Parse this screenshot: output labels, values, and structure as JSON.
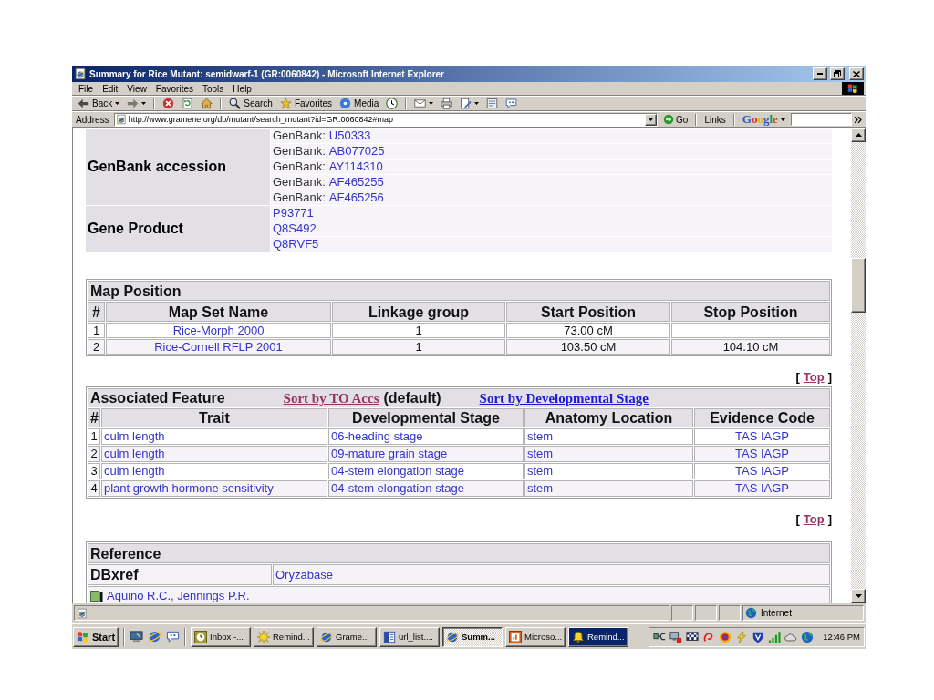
{
  "window": {
    "title": "Summary for Rice Mutant: semidwarf-1 (GR:0060842) - Microsoft Internet Explorer"
  },
  "menu": [
    "File",
    "Edit",
    "View",
    "Favorites",
    "Tools",
    "Help"
  ],
  "toolbar": [
    {
      "buttons": [
        {
          "kind": "back",
          "label": "Back"
        },
        {
          "kind": "forward"
        }
      ]
    },
    {
      "buttons": [
        {
          "kind": "stop"
        },
        {
          "kind": "refresh"
        },
        {
          "kind": "home"
        }
      ]
    },
    {
      "buttons": [
        {
          "kind": "search",
          "label": "Search"
        },
        {
          "kind": "favorites",
          "label": "Favorites"
        },
        {
          "kind": "media",
          "label": "Media"
        },
        {
          "kind": "history"
        }
      ]
    },
    {
      "buttons": [
        {
          "kind": "mail"
        },
        {
          "kind": "print"
        },
        {
          "kind": "edit"
        },
        {
          "kind": "discuss"
        },
        {
          "kind": "messenger"
        }
      ]
    }
  ],
  "address_bar": {
    "label": "Address",
    "url": "http://www.gramene.org/db/mutant/search_mutant?id=GR:0060842#map",
    "go": "Go",
    "links": "Links",
    "search_brand": "Google"
  },
  "content": {
    "xrefs": [
      {
        "label": "GenBank accession",
        "entries": [
          {
            "prefix": "GenBank:",
            "link": "U50333"
          },
          {
            "prefix": "GenBank:",
            "link": "AB077025"
          },
          {
            "prefix": "GenBank:",
            "link": "AY114310"
          },
          {
            "prefix": "GenBank:",
            "link": "AF465255"
          },
          {
            "prefix": "GenBank:",
            "link": "AF465256"
          }
        ]
      },
      {
        "label": "Gene Product",
        "entries": [
          {
            "link": "P93771"
          },
          {
            "link": "Q8S492"
          },
          {
            "link": "Q8RVF5"
          }
        ]
      }
    ],
    "map_position": {
      "title": "Map Position",
      "columns": [
        "#",
        "Map Set Name",
        "Linkage group",
        "Start Position",
        "Stop Position"
      ],
      "rows": [
        {
          "number": "1",
          "map_set": "Rice-Morph 2000",
          "linkage_group": "1",
          "start": "73.00 cM"
        },
        {
          "number": "2",
          "map_set": "Rice-Cornell RFLP 2001",
          "linkage_group": "1",
          "start": "103.50 cM",
          "stop": "104.10 cM"
        }
      ],
      "top_link": {
        "open": "[",
        "label": "Top",
        "close": "]"
      }
    },
    "associated_feature": {
      "title": "Associated Feature",
      "sort_links": [
        {
          "label": "Sort by TO Accs",
          "visited": true,
          "note": "(default)"
        },
        {
          "label": "Sort by Developmental Stage",
          "visited": false
        }
      ],
      "columns": [
        "#",
        "Trait",
        "Developmental Stage",
        "Anatomy Location",
        "Evidence Code"
      ],
      "rows": [
        {
          "number": "1",
          "trait": "culm length",
          "stage": "06-heading stage",
          "location": "stem",
          "evidence": "TAS IAGP"
        },
        {
          "number": "2",
          "trait": "culm length",
          "stage": "09-mature grain stage",
          "location": "stem",
          "evidence": "TAS IAGP"
        },
        {
          "number": "3",
          "trait": "culm length",
          "stage": "04-stem elongation stage",
          "location": "stem",
          "evidence": "TAS IAGP"
        },
        {
          "number": "4",
          "trait": "plant growth hormone sensitivity",
          "stage": "04-stem elongation stage",
          "location": "stem",
          "evidence": "TAS IAGP"
        }
      ],
      "top_link": {
        "open": "[",
        "label": "Top",
        "close": "]"
      }
    },
    "reference": {
      "title": "Reference",
      "dbxref": {
        "label": "DBxref",
        "link": "Oryzabase"
      },
      "citations": [
        "Aquino R.C., Jennings P.R."
      ]
    }
  },
  "status_bar": {
    "zone": "Internet"
  },
  "taskbar": {
    "start": "Start",
    "quick_launch": [
      {
        "kind": "desktop"
      },
      {
        "kind": "browser"
      },
      {
        "kind": "messenger"
      }
    ],
    "tasks": [
      {
        "kind": "outlook",
        "label": "Inbox -...",
        "selected": false,
        "flashing": false
      },
      {
        "kind": "reminder",
        "label": "Remind...",
        "selected": false,
        "flashing": false
      },
      {
        "kind": "browser",
        "label": "Grame...",
        "selected": false,
        "flashing": false
      },
      {
        "kind": "word",
        "label": "url_list....",
        "selected": false,
        "flashing": false
      },
      {
        "kind": "browser",
        "label": "Summ...",
        "selected": true,
        "flashing": false
      },
      {
        "kind": "powerpoint",
        "label": "Microso...",
        "selected": false,
        "flashing": false
      },
      {
        "kind": "bell",
        "label": "Remind...",
        "selected": false,
        "flashing": true
      }
    ],
    "tray": [
      {
        "kind": "plug"
      },
      {
        "kind": "monitor"
      },
      {
        "kind": "checkered"
      },
      {
        "kind": "swirl"
      },
      {
        "kind": "target"
      },
      {
        "kind": "lightning"
      },
      {
        "kind": "shield"
      },
      {
        "kind": "signal"
      },
      {
        "kind": "cloud"
      },
      {
        "kind": "globe"
      }
    ],
    "clock": "12:46 PM"
  }
}
